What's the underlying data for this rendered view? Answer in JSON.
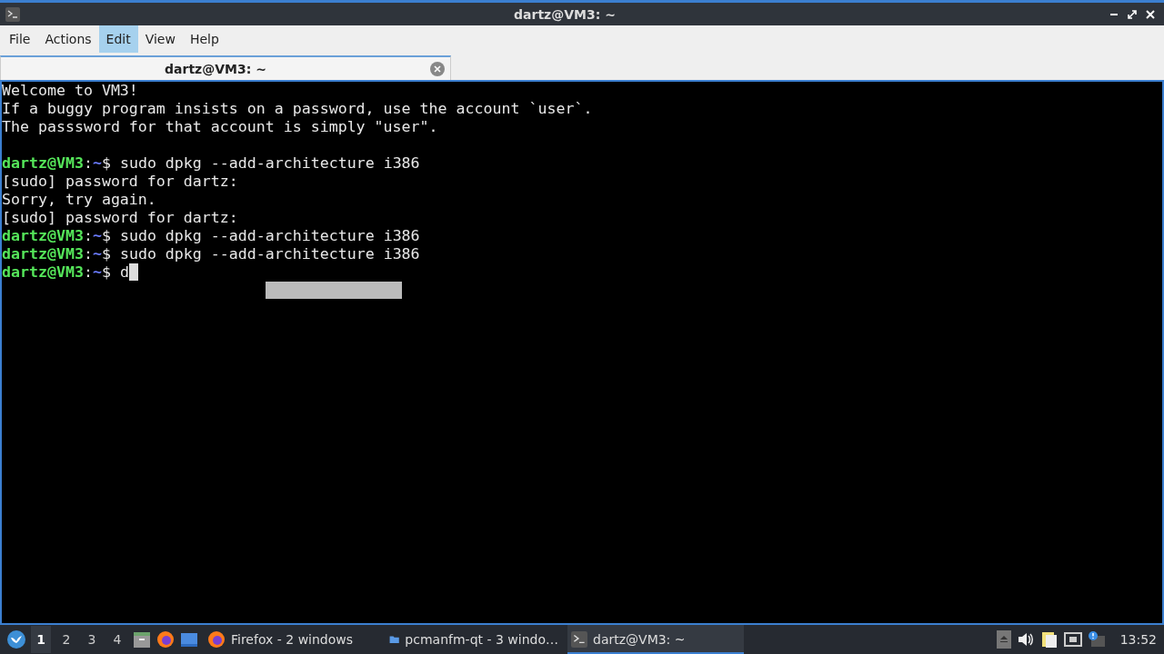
{
  "window": {
    "title": "dartz@VM3: ~"
  },
  "menu": [
    {
      "label": "File",
      "selected": false
    },
    {
      "label": "Actions",
      "selected": false
    },
    {
      "label": "Edit",
      "selected": true
    },
    {
      "label": "View",
      "selected": false
    },
    {
      "label": "Help",
      "selected": false
    }
  ],
  "tabs": [
    {
      "label": "dartz@VM3: ~",
      "selected": true
    }
  ],
  "terminal": {
    "lines": [
      {
        "kind": "output",
        "text": "Welcome to VM3!"
      },
      {
        "kind": "output",
        "text": "If a buggy program insists on a password, use the account `user`."
      },
      {
        "kind": "output",
        "text": "The passsword for that account is simply \"user\"."
      },
      {
        "kind": "blank"
      },
      {
        "kind": "prompt",
        "user": "dartz@VM3",
        "separator": ":",
        "path": "~",
        "sign": "$",
        "command": "sudo dpkg --add-architecture i386",
        "cursor": false
      },
      {
        "kind": "output",
        "text": "[sudo] password for dartz:"
      },
      {
        "kind": "output",
        "text": "Sorry, try again."
      },
      {
        "kind": "output",
        "text": "[sudo] password for dartz:"
      },
      {
        "kind": "prompt",
        "user": "dartz@VM3",
        "separator": ":",
        "path": "~",
        "sign": "$",
        "command": "sudo dpkg --add-architecture i386",
        "cursor": false
      },
      {
        "kind": "prompt",
        "user": "dartz@VM3",
        "separator": ":",
        "path": "~",
        "sign": "$",
        "command": "sudo dpkg --add-architecture i386",
        "cursor": false
      },
      {
        "kind": "prompt",
        "user": "dartz@VM3",
        "separator": ":",
        "path": "~",
        "sign": "$",
        "command": "d",
        "cursor": true
      }
    ]
  },
  "taskbar": {
    "workspaces": [
      {
        "label": "1",
        "selected": true
      },
      {
        "label": "2",
        "selected": false
      },
      {
        "label": "3",
        "selected": false
      },
      {
        "label": "4",
        "selected": false
      }
    ],
    "tasks": [
      {
        "kind": "firefox",
        "label": "Firefox - 2 windows",
        "selected": false
      },
      {
        "kind": "folder",
        "label": "pcmanfm-qt - 3 windo…",
        "selected": false
      },
      {
        "kind": "terminal",
        "label": "dartz@VM3: ~",
        "selected": true
      }
    ],
    "clock": "13:52"
  }
}
